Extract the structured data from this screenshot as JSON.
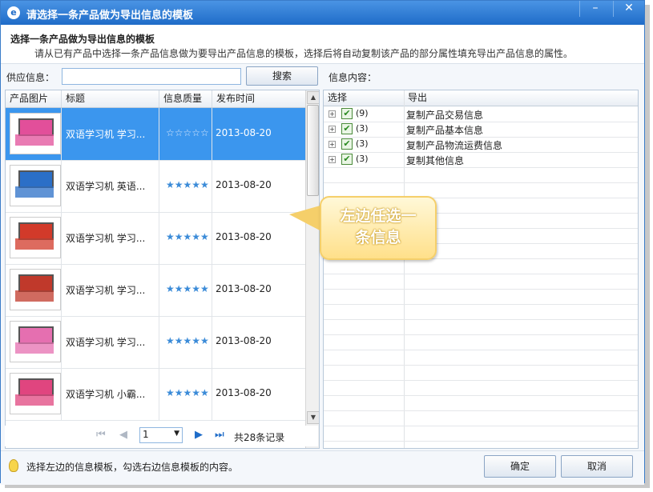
{
  "window": {
    "title": "请选择一条产品做为导出信息的模板",
    "icon": "e",
    "minimize_glyph": "–",
    "close_glyph": "✕"
  },
  "header": {
    "title": "选择一条产品做为导出信息的模板",
    "subtitle": "请从已有产品中选择一条产品信息做为要导出产品信息的模板，选择后将自动复制该产品的部分属性填充导出产品信息的属性。"
  },
  "search": {
    "supplier_label": "供应信息：",
    "value": "",
    "button": "搜索"
  },
  "right_panel": {
    "label": "信息内容：",
    "columns": [
      "选择",
      "导出"
    ],
    "rows": [
      {
        "count": "(9)",
        "name": "复制产品交易信息",
        "checked": true
      },
      {
        "count": "(3)",
        "name": "复制产品基本信息",
        "checked": true
      },
      {
        "count": "(3)",
        "name": "复制产品物流运费信息",
        "checked": true
      },
      {
        "count": "(3)",
        "name": "复制其他信息",
        "checked": true
      }
    ]
  },
  "products": {
    "columns": [
      "产品图片",
      "标题",
      "信息质量",
      "发布时间"
    ],
    "rows": [
      {
        "title": "双语学习机 学习...",
        "quality": "☆☆☆☆☆",
        "date": "2013-08-20",
        "selected": true,
        "color": "#e24f9a"
      },
      {
        "title": "双语学习机 英语...",
        "quality": "★★★★★",
        "date": "2013-08-20",
        "selected": false,
        "color": "#2b6fc7"
      },
      {
        "title": "双语学习机 学习...",
        "quality": "★★★★★",
        "date": "2013-08-20",
        "selected": false,
        "color": "#d23a2a"
      },
      {
        "title": "双语学习机 学习...",
        "quality": "★★★★★",
        "date": "2013-08-20",
        "selected": false,
        "color": "#c0392b"
      },
      {
        "title": "双语学习机 学习...",
        "quality": "★★★★★",
        "date": "2013-08-20",
        "selected": false,
        "color": "#e56fb0"
      },
      {
        "title": "双语学习机 小霸...",
        "quality": "★★★★★",
        "date": "2013-08-20",
        "selected": false,
        "color": "#e0457f"
      }
    ]
  },
  "pager": {
    "first": "⏮",
    "prev": "◀",
    "page": "1",
    "next": "▶",
    "last": "⏭",
    "total": "共28条记录"
  },
  "callout": {
    "line1": "左边任选一",
    "line2": "条信息"
  },
  "footer": {
    "tip": "选择左边的信息模板，勾选右边信息模板的内容。",
    "ok": "确定",
    "cancel": "取消"
  }
}
